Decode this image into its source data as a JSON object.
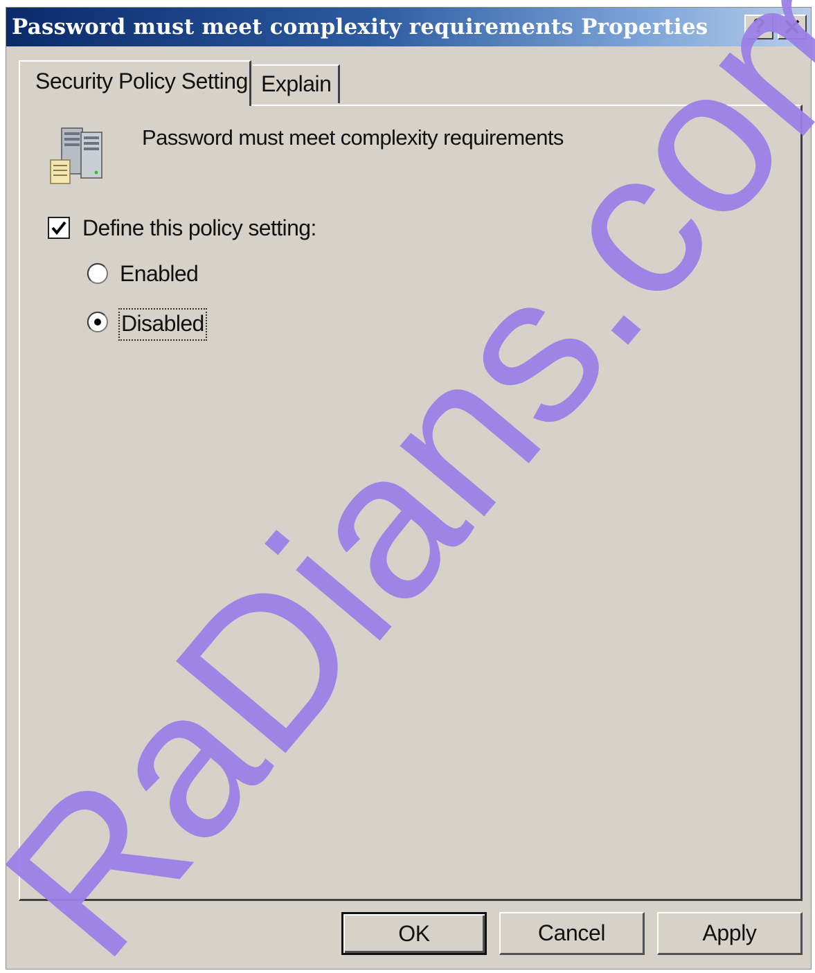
{
  "window": {
    "title": "Password must meet complexity requirements Properties",
    "help_label": "?",
    "close_label": "✕"
  },
  "tabs": [
    {
      "label": "Security Policy Setting",
      "active": true
    },
    {
      "label": "Explain",
      "active": false
    }
  ],
  "policy": {
    "name": "Password must meet complexity requirements",
    "icon": "server-policy-icon"
  },
  "define_setting": {
    "label": "Define this policy setting:",
    "checked": true
  },
  "options": [
    {
      "label": "Enabled",
      "selected": false
    },
    {
      "label": "Disabled",
      "selected": true
    }
  ],
  "buttons": {
    "ok": "OK",
    "cancel": "Cancel",
    "apply": "Apply"
  },
  "watermark": {
    "text": "RaDians.com.ar",
    "color": "#9b7fe6"
  },
  "colors": {
    "dialog_bg": "#d6d2ca",
    "titlebar_dark": "#0a2a6b",
    "titlebar_light": "#b9cdea"
  }
}
